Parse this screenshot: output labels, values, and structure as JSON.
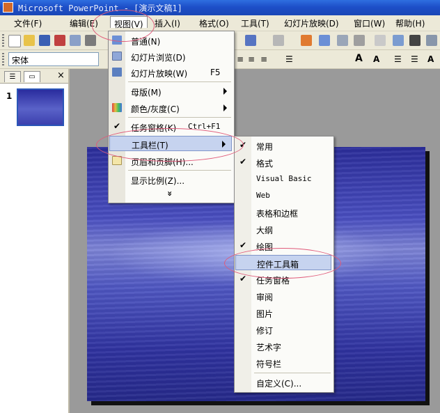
{
  "window": {
    "title": "Microsoft PowerPoint - [演示文稿1]"
  },
  "menubar": {
    "items": [
      "文件(F)",
      "编辑(E)",
      "视图(V)",
      "插入(I)",
      "格式(O)",
      "工具(T)",
      "幻灯片放映(D)",
      "窗口(W)",
      "帮助(H)"
    ]
  },
  "formatting": {
    "font_name": "宋体"
  },
  "slides_pane": {
    "slide_number": "1"
  },
  "view_menu": {
    "items": [
      {
        "label": "普通(N)"
      },
      {
        "label": "幻灯片浏览(D)"
      },
      {
        "label": "幻灯片放映(W)",
        "shortcut": "F5"
      },
      {
        "label": "母版(M)"
      },
      {
        "label": "颜色/灰度(C)"
      },
      {
        "label": "任务窗格(K)",
        "shortcut": "Ctrl+F1"
      },
      {
        "label": "工具栏(T)"
      },
      {
        "label": "页眉和页脚(H)..."
      },
      {
        "label": "显示比例(Z)..."
      }
    ],
    "expand": "»"
  },
  "toolbars_submenu": {
    "items": [
      "常用",
      "格式",
      "Visual Basic",
      "Web",
      "表格和边框",
      "大纲",
      "绘图",
      "控件工具箱",
      "任务窗格",
      "审阅",
      "图片",
      "修订",
      "艺术字",
      "符号栏",
      "自定义(C)..."
    ],
    "checked": [
      "常用",
      "格式",
      "绘图",
      "任务窗格"
    ],
    "highlighted": "控件工具箱"
  },
  "colors": {
    "title_bar": "#1d4fc8",
    "menu_highlight": "#c6d3ef",
    "annotation": "#e05a7a"
  }
}
